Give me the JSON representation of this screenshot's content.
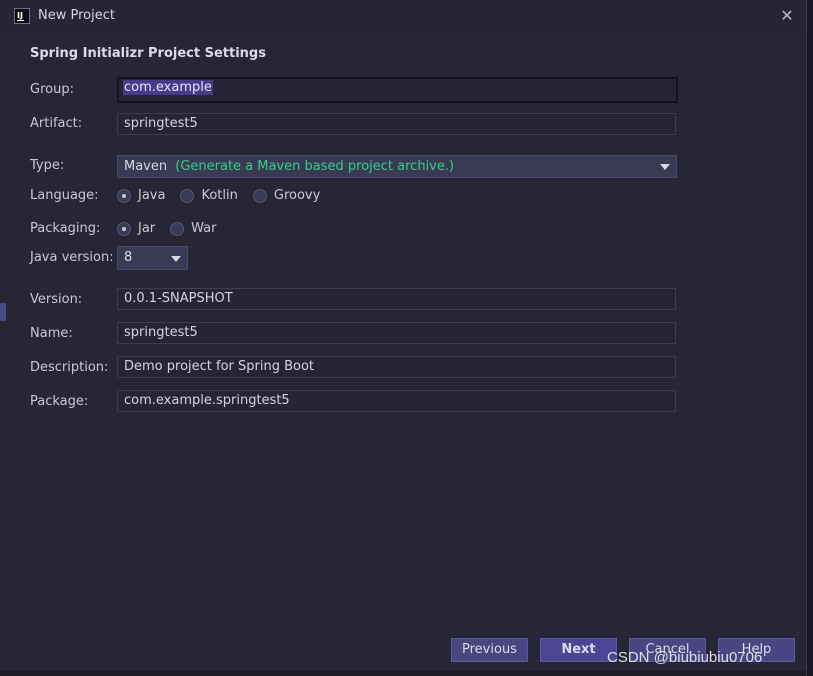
{
  "window": {
    "title": "New Project"
  },
  "section_title": "Spring Initializr Project Settings",
  "fields": {
    "group": {
      "label": "Group:",
      "value": "com.example"
    },
    "artifact": {
      "label": "Artifact:",
      "value": "springtest5"
    },
    "type": {
      "label": "Type:",
      "value": "Maven",
      "hint": "(Generate a Maven based project archive.)"
    },
    "language": {
      "label": "Language:",
      "options": [
        "Java",
        "Kotlin",
        "Groovy"
      ],
      "selected": "Java"
    },
    "packaging": {
      "label": "Packaging:",
      "options": [
        "Jar",
        "War"
      ],
      "selected": "Jar"
    },
    "java_version": {
      "label": "Java version:",
      "value": "8"
    },
    "version": {
      "label": "Version:",
      "value": "0.0.1-SNAPSHOT"
    },
    "name": {
      "label": "Name:",
      "value": "springtest5"
    },
    "description": {
      "label": "Description:",
      "value": "Demo project for Spring Boot"
    },
    "package": {
      "label": "Package:",
      "value": "com.example.springtest5"
    }
  },
  "buttons": {
    "previous": "Previous",
    "next": "Next",
    "cancel": "Cancel",
    "help": "Help"
  },
  "watermark": "CSDN @biubiubiu0706",
  "icons": {
    "app": "intellij-icon",
    "close": "close-icon"
  }
}
